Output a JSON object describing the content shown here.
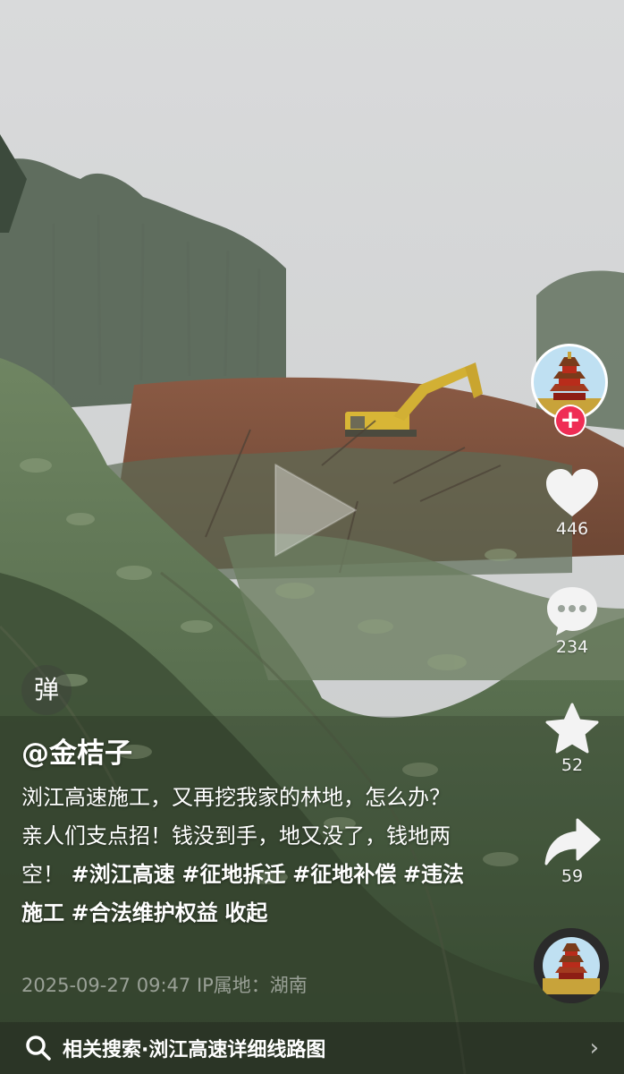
{
  "author": {
    "username": "@金桔子"
  },
  "description": {
    "text": "浏江高速施工，又再挖我家的林地，怎么办？亲人们支点招！钱没到手，地又没了，钱地两空！",
    "hashtags": [
      "#浏江高速",
      "#征地拆迁",
      "#征地补偿",
      "#违法施工",
      "#合法维护权益"
    ],
    "collapse_label": "收起"
  },
  "post_meta": {
    "datetime": "2025-09-27 09:47",
    "ip_location": "IP属地：湖南"
  },
  "actions": {
    "likes": "446",
    "comments": "234",
    "favorites": "52",
    "shares": "59",
    "follow_symbol": "+"
  },
  "danmu": {
    "label": "弹"
  },
  "related_search": {
    "label": "相关搜索·浏江高速详细线路图"
  },
  "icons": [
    "play-icon",
    "heart-icon",
    "comment-icon",
    "star-icon",
    "share-icon",
    "search-icon",
    "chevron-right-icon"
  ],
  "colors": {
    "follow_badge": "#ef2d55",
    "text": "#ffffff"
  }
}
